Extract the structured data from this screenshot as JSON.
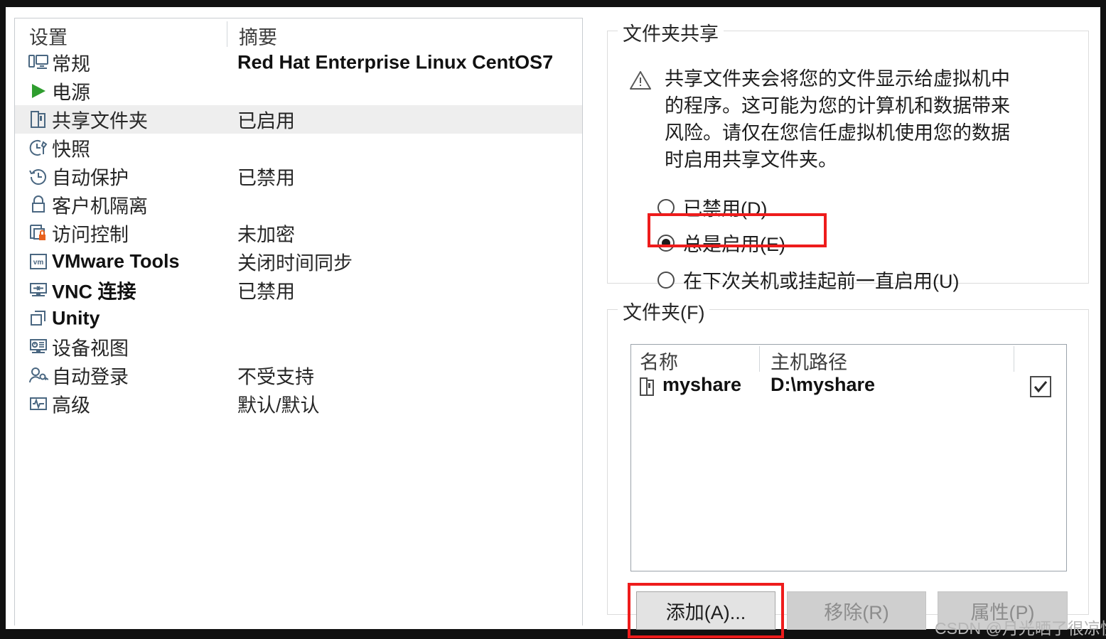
{
  "settings_list": {
    "columns": [
      "设置",
      "摘要"
    ],
    "rows": [
      {
        "icon": "monitor-icon",
        "label": "常规",
        "summary": "Red Hat Enterprise Linux CentOS7",
        "latin_label": false,
        "latin_summary": true,
        "selected": false
      },
      {
        "icon": "play-icon",
        "label": "电源",
        "summary": "",
        "latin_label": false,
        "latin_summary": false,
        "selected": false
      },
      {
        "icon": "shared-folder-icon",
        "label": "共享文件夹",
        "summary": "已启用",
        "latin_label": false,
        "latin_summary": false,
        "selected": true
      },
      {
        "icon": "snapshot-icon",
        "label": "快照",
        "summary": "",
        "latin_label": false,
        "latin_summary": false,
        "selected": false
      },
      {
        "icon": "autoprotect-icon",
        "label": "自动保护",
        "summary": "已禁用",
        "latin_label": false,
        "latin_summary": false,
        "selected": false
      },
      {
        "icon": "lock-icon",
        "label": "客户机隔离",
        "summary": "",
        "latin_label": false,
        "latin_summary": false,
        "selected": false
      },
      {
        "icon": "access-control-icon",
        "label": "访问控制",
        "summary": "未加密",
        "latin_label": false,
        "latin_summary": false,
        "selected": false
      },
      {
        "icon": "vmware-tools-icon",
        "label": "VMware Tools",
        "summary": "关闭时间同步",
        "latin_label": true,
        "latin_summary": false,
        "selected": false
      },
      {
        "icon": "vnc-icon",
        "label": "VNC 连接",
        "summary": "已禁用",
        "latin_label": true,
        "latin_summary": false,
        "selected": false
      },
      {
        "icon": "unity-icon",
        "label": "Unity",
        "summary": "",
        "latin_label": true,
        "latin_summary": false,
        "selected": false
      },
      {
        "icon": "device-view-icon",
        "label": "设备视图",
        "summary": "",
        "latin_label": false,
        "latin_summary": false,
        "selected": false
      },
      {
        "icon": "auto-login-icon",
        "label": "自动登录",
        "summary": "不受支持",
        "latin_label": false,
        "latin_summary": false,
        "selected": false
      },
      {
        "icon": "advanced-icon",
        "label": "高级",
        "summary": "默认/默认",
        "latin_label": false,
        "latin_summary": false,
        "selected": false
      }
    ]
  },
  "folder_sharing": {
    "title": "文件夹共享",
    "warning_icon": "warning-triangle-icon",
    "warning_text": "共享文件夹会将您的文件显示给虚拟机中的程序。这可能为您的计算机和数据带来风险。请仅在您信任虚拟机使用您的数据时启用共享文件夹。",
    "options": [
      {
        "label": "已禁用(D)",
        "checked": false
      },
      {
        "label": "总是启用(E)",
        "checked": true
      },
      {
        "label": "在下次关机或挂起前一直启用(U)",
        "checked": false
      }
    ]
  },
  "folders": {
    "title": "文件夹(F)",
    "columns": [
      "名称",
      "主机路径",
      ""
    ],
    "rows": [
      {
        "icon": "folder-icon",
        "name": "myshare",
        "path": "D:\\myshare",
        "enabled": true
      }
    ],
    "buttons": [
      {
        "label": "添加(A)...",
        "enabled": true,
        "highlighted": true
      },
      {
        "label": "移除(R)",
        "enabled": false,
        "highlighted": false
      },
      {
        "label": "属性(P)",
        "enabled": false,
        "highlighted": false
      }
    ]
  },
  "watermark": "CSDN @月光晒了很凉快",
  "colors": {
    "highlight_red": "#ee1c1c",
    "selected_row": "#eeeeee",
    "icon_blue": "#4a6781",
    "play_green": "#2f9e2f",
    "lock_orange": "#e8601c"
  }
}
